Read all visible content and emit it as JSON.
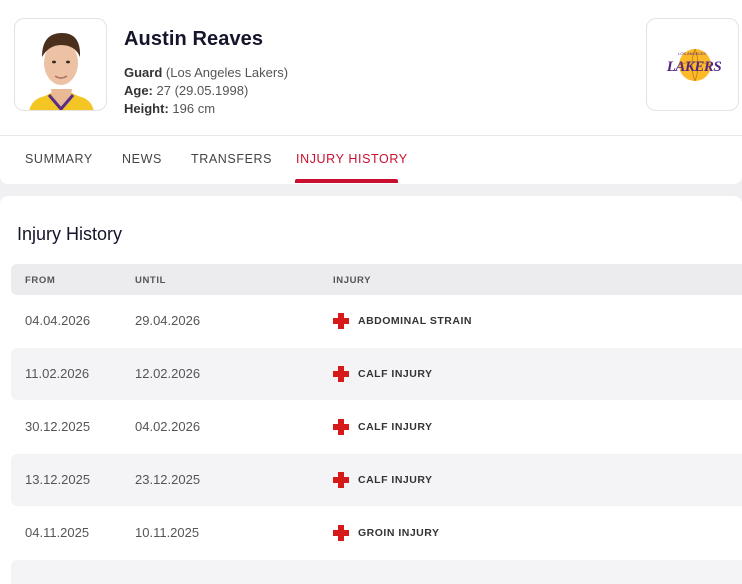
{
  "player": {
    "name": "Austin Reaves",
    "position": "Guard",
    "team": "(Los Angeles Lakers)",
    "age_label": "Age:",
    "age_value": "27 (29.05.1998)",
    "height_label": "Height:",
    "height_value": "196 cm"
  },
  "team_logo": {
    "text": "LAKERS",
    "small_text": "LOS ANGELES",
    "colors": {
      "purple": "#552583",
      "gold": "#FDB927"
    }
  },
  "tabs": [
    {
      "label": "SUMMARY",
      "active": false
    },
    {
      "label": "NEWS",
      "active": false
    },
    {
      "label": "TRANSFERS",
      "active": false
    },
    {
      "label": "INJURY HISTORY",
      "active": true
    }
  ],
  "section_title": "Injury History",
  "table": {
    "headers": [
      "FROM",
      "UNTIL",
      "INJURY"
    ],
    "rows": [
      {
        "from": "04.04.2026",
        "until": "29.04.2026",
        "injury": "ABDOMINAL STRAIN"
      },
      {
        "from": "11.02.2026",
        "until": "12.02.2026",
        "injury": "CALF INJURY"
      },
      {
        "from": "30.12.2025",
        "until": "04.02.2026",
        "injury": "CALF INJURY"
      },
      {
        "from": "13.12.2025",
        "until": "23.12.2025",
        "injury": "CALF INJURY"
      },
      {
        "from": "04.11.2025",
        "until": "10.11.2025",
        "injury": "GROIN INJURY"
      }
    ]
  },
  "colors": {
    "accent": "#c8102e",
    "injury_icon": "#d61a1a"
  }
}
